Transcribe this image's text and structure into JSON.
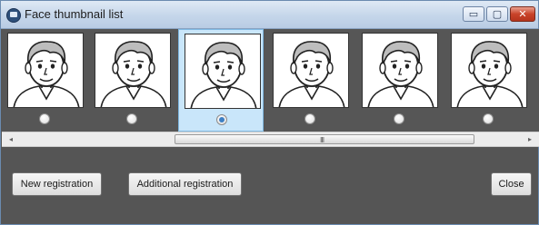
{
  "window": {
    "title": "Face thumbnail list",
    "minimize_glyph": "▭",
    "maximize_glyph": "▢",
    "close_glyph": "✕"
  },
  "thumbnails": [
    {
      "selected": false
    },
    {
      "selected": false
    },
    {
      "selected": true
    },
    {
      "selected": false
    },
    {
      "selected": false
    },
    {
      "selected": false
    }
  ],
  "scrollbar": {
    "left_arrow": "◂",
    "right_arrow": "▸",
    "grip": "III"
  },
  "actions": {
    "new_registration": "New registration",
    "additional_registration": "Additional registration",
    "close": "Close"
  }
}
